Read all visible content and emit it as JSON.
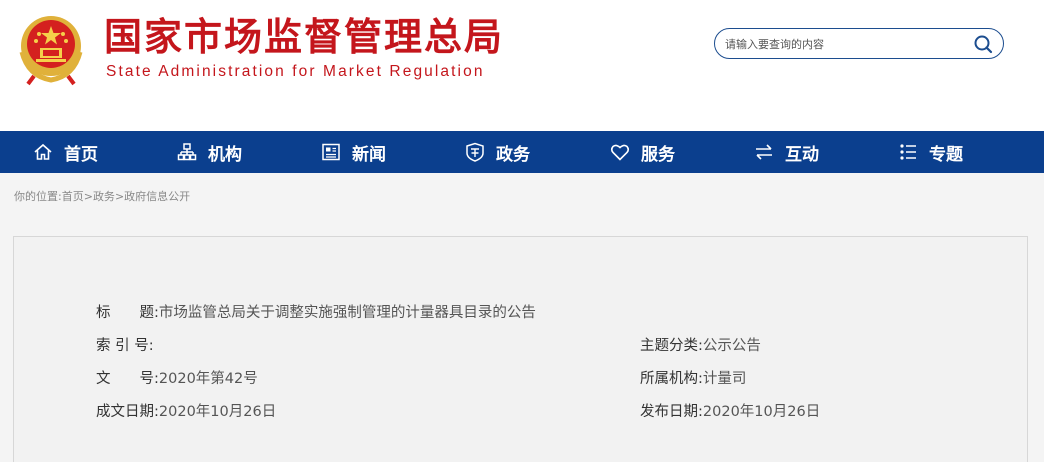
{
  "header": {
    "title_cn": "国家市场监督管理总局",
    "title_en": "State Administration for Market Regulation",
    "emblem_icon": "national-emblem-icon",
    "brand_color": "#c4161c"
  },
  "search": {
    "placeholder": "请输入要查询的内容",
    "icon": "search-icon"
  },
  "nav": {
    "background": "#0b3f8e",
    "items": [
      {
        "label": "首页",
        "icon": "home-icon"
      },
      {
        "label": "机构",
        "icon": "org-chart-icon"
      },
      {
        "label": "新闻",
        "icon": "newspaper-icon"
      },
      {
        "label": "政务",
        "icon": "shield-icon"
      },
      {
        "label": "服务",
        "icon": "heart-icon"
      },
      {
        "label": "互动",
        "icon": "exchange-icon"
      },
      {
        "label": "专题",
        "icon": "list-icon"
      }
    ]
  },
  "breadcrumb": {
    "prefix": "你的位置:",
    "items": [
      "首页",
      "政务",
      "政府信息公开"
    ],
    "separator": ">"
  },
  "info": {
    "title_label": "标　　题:",
    "title_value": "市场监管总局关于调整实施强制管理的计量器具目录的公告",
    "index_label": "索 引 号:",
    "index_value": "",
    "subject_label": "主题分类:",
    "subject_value": "公示公告",
    "doc_no_label": "文　　号:",
    "doc_no_value": "2020年第42号",
    "agency_label": "所属机构:",
    "agency_value": "计量司",
    "written_label": "成文日期:",
    "written_value": "2020年10月26日",
    "publish_label": "发布日期:",
    "publish_value": "2020年10月26日"
  }
}
